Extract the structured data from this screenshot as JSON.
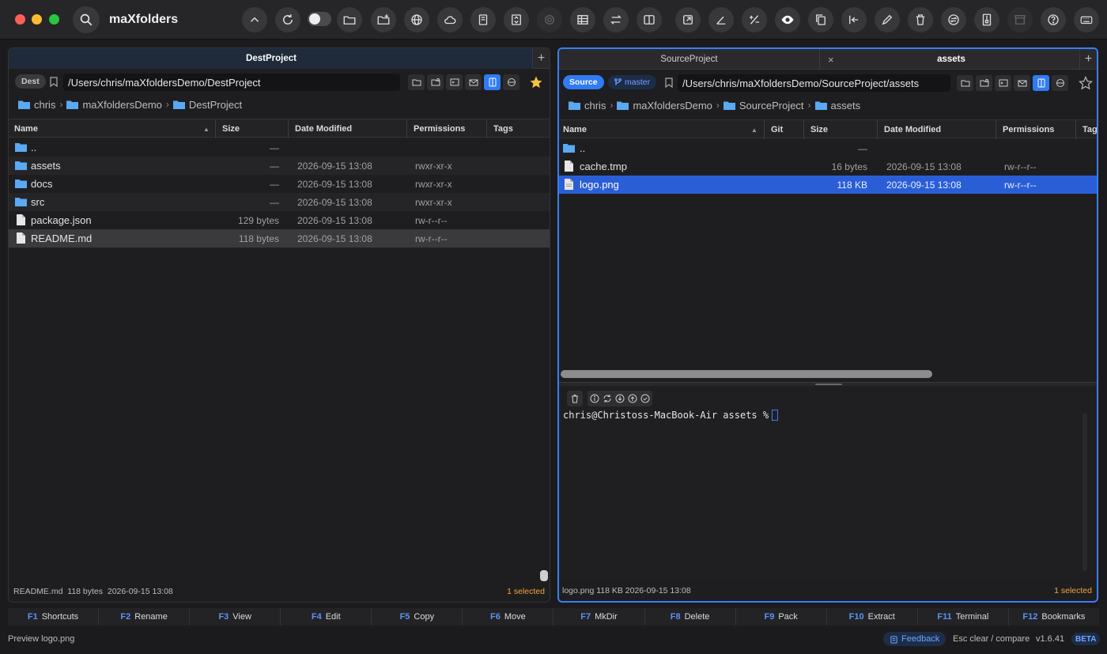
{
  "app": {
    "title": "maXfolders"
  },
  "toolbar": {
    "icons": [
      "up-arrow-icon",
      "refresh-icon",
      "toggle",
      "folder-icon",
      "new-folder-icon",
      "globe-icon",
      "cloud-icon",
      "book-icon",
      "archive-icon",
      "settings-icon",
      "table-icon",
      "swap-icon",
      "split-view-icon",
      "external-link-icon",
      "angle-icon",
      "plus-minus-icon",
      "eye-icon",
      "copy-icon",
      "back-icon",
      "pencil-icon",
      "trash-icon",
      "sync-icon",
      "zip-icon",
      "box-icon",
      "help-icon",
      "keyboard-icon"
    ]
  },
  "left": {
    "tab": "DestProject",
    "badge": "Dest",
    "path": "/Users/chris/maXfoldersDemo/DestProject",
    "crumbs": [
      "chris",
      "maXfoldersDemo",
      "DestProject"
    ],
    "columns": {
      "name": "Name",
      "size": "Size",
      "date": "Date Modified",
      "perm": "Permissions",
      "tags": "Tags"
    },
    "rows": [
      {
        "name": "..",
        "type": "folder",
        "size": "—",
        "date": "",
        "perm": ""
      },
      {
        "name": "assets",
        "type": "folder",
        "size": "—",
        "date": "2026-09-15 13:08",
        "perm": "rwxr-xr-x"
      },
      {
        "name": "docs",
        "type": "folder",
        "size": "—",
        "date": "2026-09-15 13:08",
        "perm": "rwxr-xr-x"
      },
      {
        "name": "src",
        "type": "folder",
        "size": "—",
        "date": "2026-09-15 13:08",
        "perm": "rwxr-xr-x"
      },
      {
        "name": "package.json",
        "type": "file",
        "size": "129 bytes",
        "date": "2026-09-15 13:08",
        "perm": "rw-r--r--"
      },
      {
        "name": "README.md",
        "type": "file",
        "size": "118 bytes",
        "date": "2026-09-15 13:08",
        "perm": "rw-r--r--"
      }
    ],
    "status": "README.md  118 bytes  2026-09-15 13:08",
    "selected": "1 selected"
  },
  "right": {
    "tabs": [
      "SourceProject",
      "assets"
    ],
    "badge": "Source",
    "branch": "master",
    "path": "/Users/chris/maXfoldersDemo/SourceProject/assets",
    "crumbs": [
      "chris",
      "maXfoldersDemo",
      "SourceProject",
      "assets"
    ],
    "columns": {
      "name": "Name",
      "git": "Git",
      "size": "Size",
      "date": "Date Modified",
      "perm": "Permissions",
      "tags": "Tags"
    },
    "rows": [
      {
        "name": "..",
        "type": "folder",
        "size": "—",
        "date": "",
        "perm": ""
      },
      {
        "name": "cache.tmp",
        "type": "file",
        "size": "16 bytes",
        "date": "2026-09-15 13:08",
        "perm": "rw-r--r--"
      },
      {
        "name": "logo.png",
        "type": "file",
        "size": "118 KB",
        "date": "2026-09-15 13:08",
        "perm": "rw-r--r--"
      }
    ],
    "terminal": {
      "prompt": "chris@Christoss-MacBook-Air assets %"
    },
    "status": "logo.png  118 KB  2026-09-15 13:08",
    "selected": "1 selected"
  },
  "fnkeys": [
    {
      "key": "F1",
      "label": "Shortcuts"
    },
    {
      "key": "F2",
      "label": "Rename"
    },
    {
      "key": "F3",
      "label": "View"
    },
    {
      "key": "F4",
      "label": "Edit"
    },
    {
      "key": "F5",
      "label": "Copy"
    },
    {
      "key": "F6",
      "label": "Move"
    },
    {
      "key": "F7",
      "label": "MkDir"
    },
    {
      "key": "F8",
      "label": "Delete"
    },
    {
      "key": "F9",
      "label": "Pack"
    },
    {
      "key": "F10",
      "label": "Extract"
    },
    {
      "key": "F11",
      "label": "Terminal"
    },
    {
      "key": "F12",
      "label": "Bookmarks"
    }
  ],
  "bottom": {
    "preview": "Preview logo.png",
    "feedback": "Feedback",
    "hint": "Esc clear / compare",
    "version": "v1.6.41",
    "beta": "BETA"
  },
  "colors": {
    "accent": "#2f7bf5",
    "selection": "#2a5ed6",
    "folder": "#5aa9f2",
    "warning": "#f0a43a"
  }
}
